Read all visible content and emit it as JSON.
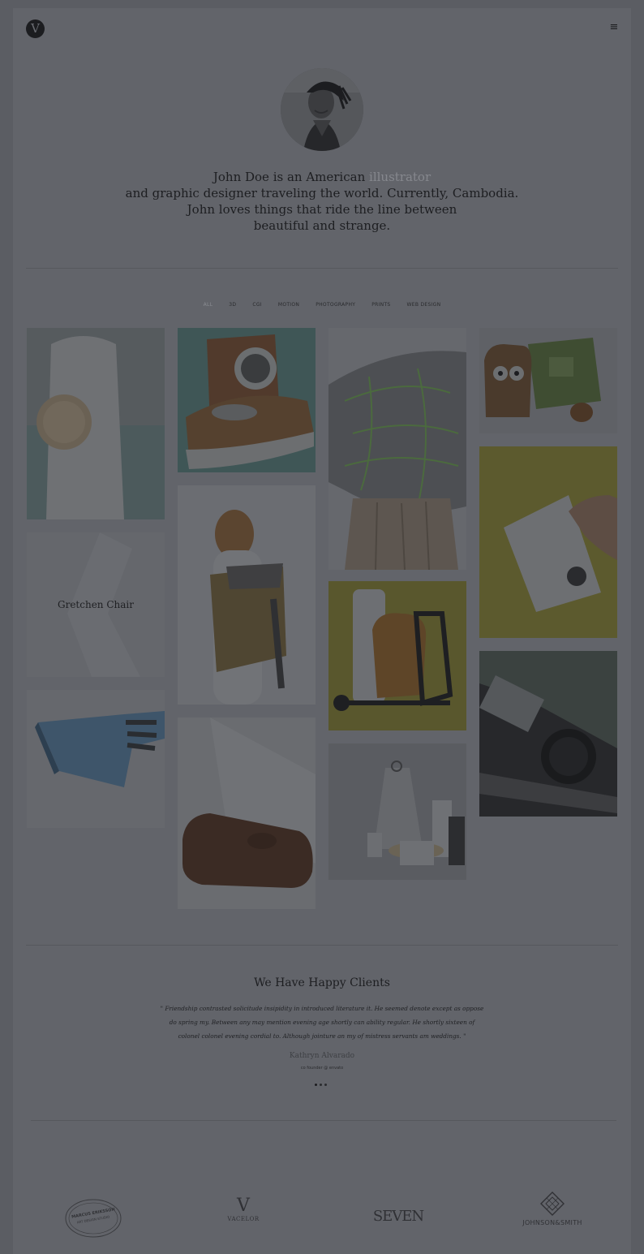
{
  "header": {
    "logo_letter": "V",
    "menu_icon": "≡"
  },
  "intro": {
    "line1_pre": "John Doe is an American ",
    "line1_accent": "illustrator",
    "line2": "and graphic designer traveling the world. Currently, Cambodia.",
    "line3": "John loves things that ride the line between",
    "line4": "beautiful and strange."
  },
  "filters": [
    "ALL",
    "3D",
    "CGI",
    "MOTION",
    "PHOTOGRAPHY",
    "PRINTS",
    "WEB DESIGN"
  ],
  "portfolio": {
    "caption": "Gretchen Chair"
  },
  "clients": {
    "title": "We Have Happy Clients",
    "quote": "\" Friendship contrasted solicitude insipidity in introduced literature it. He seemed denote except as oppose do spring my. Between any may mention evening age shortly can ability regular. He shortly sixteen of colonel colonel evening cordial to. Although jointure an my of mistress servants am weddings. \"",
    "author": "Kathryn Alvarado",
    "role": "co founder @ envato"
  },
  "client_logos": {
    "marcus_line1": "MARCUS ERIKSSON",
    "marcus_line2": "ART DESIGN STUDIO",
    "vacelor": "VACELOR",
    "vacelor_letter": "V",
    "seven": "SEVEN",
    "johnson": "JOHNSON&SMITH"
  },
  "colors": {
    "background": "#5b5d63",
    "accent": "#86888e",
    "text": "#1e1f22"
  }
}
